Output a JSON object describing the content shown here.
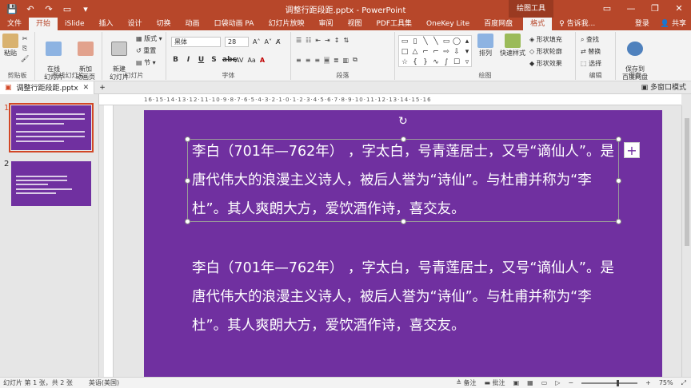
{
  "window": {
    "title": "调整行距段距.pptx - PowerPoint",
    "contextual_label": "绘图工具",
    "minimize": "—",
    "restore": "❐",
    "close": "✕"
  },
  "qat": {
    "save": "💾",
    "undo": "↶",
    "redo": "↷",
    "present": "▭",
    "more": "▾"
  },
  "tabs": [
    "文件",
    "开始",
    "iSlide",
    "插入",
    "设计",
    "切换",
    "动画",
    "口袋动画 PA",
    "幻灯片放映",
    "审阅",
    "视图",
    "PDF工具集",
    "OneKey Lite",
    "百度网盘"
  ],
  "active_tab": "开始",
  "format_tab": "格式",
  "tell_me": "♀ 告诉我...",
  "login": "登录",
  "share": "共享",
  "ribbon": {
    "clipboard": {
      "paste": "粘贴",
      "label": "剪贴板"
    },
    "online_slides": {
      "btn": "在线\n幻灯片",
      "btn2": "新加\n动画页",
      "label": "在线幻灯片"
    },
    "slides": {
      "new": "新建\n幻灯片",
      "layout": "版式",
      "reset": "重置",
      "section": "节",
      "label": "幻灯片"
    },
    "font": {
      "name": "黑体",
      "size": "28",
      "label": "字体"
    },
    "paragraph": {
      "label": "段落"
    },
    "drawing": {
      "arrange": "排列",
      "quickstyle": "快速样式",
      "fill": "形状填充",
      "outline": "形状轮廓",
      "effect": "形状效果",
      "label": "绘图"
    },
    "editing": {
      "find": "查找",
      "replace": "替换",
      "select": "选择",
      "label": "编辑"
    },
    "save": {
      "btn": "保存到\n百度网盘",
      "label": "保存"
    }
  },
  "doc_tab": {
    "name": "调整行距段距.pptx",
    "close": "✕",
    "add": "+"
  },
  "multi_window": "多窗口模式",
  "ruler_text": "16·15·14·13·12·11·10·9·8·7·6·5·4·3·2·1·0·1·2·3·4·5·6·7·8·9·10·11·12·13·14·15·16",
  "thumbnails": [
    {
      "num": "1",
      "selected": true
    },
    {
      "num": "2",
      "selected": false
    }
  ],
  "slide": {
    "background": "#7030a0",
    "paragraph1": "李白（701年—762年）  ，字太白，号青莲居士，又号“谪仙人”。是唐代伟大的浪漫主义诗人，被后人誉为“诗仙”。与杜甫并称为“李杜”。其人爽朗大方，爱饮酒作诗，喜交友。",
    "paragraph2": "李白（701年—762年）  ，字太白，号青莲居士，又号“谪仙人”。是唐代伟大的浪漫主义诗人，被后人誉为“诗仙”。与杜甫并称为“李杜”。其人爽朗大方，爱饮酒作诗，喜交友。"
  },
  "status": {
    "slide_info": "幻灯片 第 1 张，共 2 张",
    "language": "英语(美国)",
    "notes": "≜ 备注",
    "comments": "▬ 批注",
    "zoom": "75%"
  }
}
